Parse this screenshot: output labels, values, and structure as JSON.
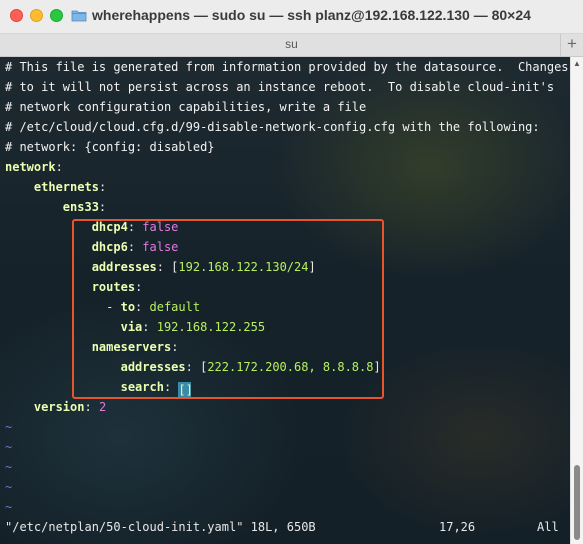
{
  "window": {
    "title": "wherehappens — sudo su — ssh planz@192.168.122.130 — 80×24",
    "tab_label": "su",
    "new_tab_symbol": "+"
  },
  "editor": {
    "comments": [
      "# This file is generated from information provided by the datasource.  Changes",
      "# to it will not persist across an instance reboot.  To disable cloud-init's",
      "# network configuration capabilities, write a file",
      "# /etc/cloud/cloud.cfg.d/99-disable-network-config.cfg with the following:",
      "# network: {config: disabled}"
    ],
    "yaml": {
      "network_key": "network",
      "ethernets_key": "ethernets",
      "iface_key": "ens33",
      "dhcp4_key": "dhcp4",
      "dhcp4_val": "false",
      "dhcp6_key": "dhcp6",
      "dhcp6_val": "false",
      "addresses_key": "addresses",
      "addresses_val": "192.168.122.130/24",
      "routes_key": "routes",
      "to_key": "to",
      "to_val": "default",
      "via_key": "via",
      "via_val": "192.168.122.255",
      "nameservers_key": "nameservers",
      "ns_addresses_key": "addresses",
      "ns_addresses_val": "222.172.200.68, 8.8.8.8",
      "search_key": "search",
      "search_cursor": "[]",
      "version_key": "version",
      "version_val": "2"
    },
    "empty_line_marker": "~",
    "status": {
      "file_info": "\"/etc/netplan/50-cloud-init.yaml\" 18L, 650B",
      "cursor_position": "17,26",
      "scroll_position": "All"
    }
  },
  "colors": {
    "highlight_box": "#e5562b",
    "key": "#eaffb0",
    "value": "#b8f060",
    "boolean": "#e07be0",
    "tilde": "#7a6bd8"
  }
}
